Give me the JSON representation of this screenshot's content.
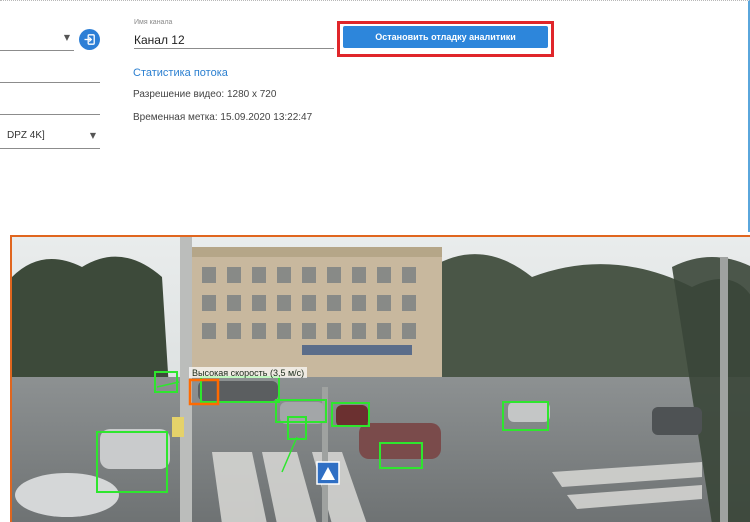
{
  "left_fields": {
    "field1_value": "",
    "field4_value": "DPZ 4K]"
  },
  "channel": {
    "caption": "Имя канала",
    "name": "Канал 12"
  },
  "toolbar": {
    "stop_label": "Остановить отладку аналитики"
  },
  "stats": {
    "title": "Статистика потока",
    "resolution": "Разрешение видео: 1280 x 720",
    "timestamp": "Временная метка: 15.09.2020 13:22:47"
  },
  "video": {
    "speed_label": "Высокая скорость (3,5 м/с)",
    "detection_color": "#2ee62e",
    "highlight_color": "#ff6a00"
  },
  "colors": {
    "accent": "#2d86db",
    "highlight_frame": "#e0262a",
    "link": "#2b7fd0"
  }
}
